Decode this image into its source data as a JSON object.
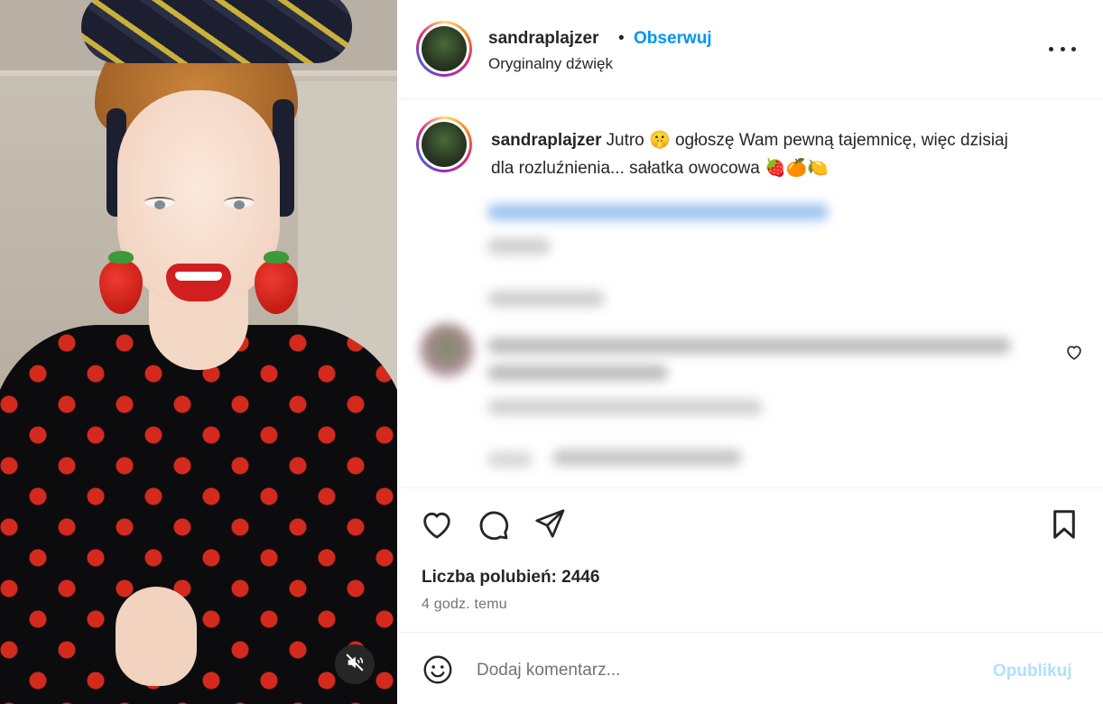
{
  "post": {
    "author": {
      "username": "sandraplajzer",
      "follow_separator": "•",
      "follow_label": "Obserwuj",
      "audio_label": "Oryginalny dźwięk"
    },
    "caption": {
      "username": "sandraplajzer",
      "text": "Jutro 🤫 ogłoszę Wam pewną tajemnicę, więc dzisiaj dla rozluźnienia... sałatka owocowa 🍓🍊🍋"
    },
    "likes_label": "Liczba polubień: 2446",
    "time_label": "4 godz. temu",
    "comment": {
      "placeholder": "Dodaj komentarz...",
      "publish_label": "Opublikuj"
    }
  },
  "icons": {
    "more": "more-options-icon",
    "like": "heart-icon",
    "comment": "comment-icon",
    "share": "share-icon",
    "save": "bookmark-icon",
    "emoji": "emoji-icon",
    "mute": "muted-speaker-icon"
  },
  "colors": {
    "accent": "#0095f6",
    "publish_disabled": "#b2dffc",
    "text": "#262626",
    "secondary_text": "#737373"
  }
}
